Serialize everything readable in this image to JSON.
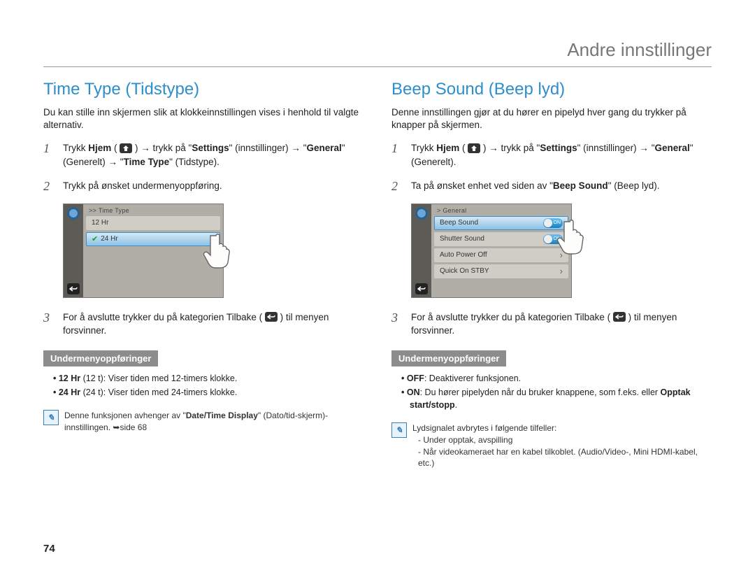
{
  "header": {
    "title": "Andre innstillinger"
  },
  "page_number": "74",
  "left": {
    "h2": "Time Type (Tidstype)",
    "intro": "Du kan stille inn skjermen slik at klokkeinnstillingen vises i henhold til valgte alternativ.",
    "step1": {
      "num": "1",
      "t1": "Trykk ",
      "hjem": "Hjem",
      "t2": " ( ",
      "t3": " ) ",
      "mid": " trykk på \"",
      "settings": "Settings",
      "t4": "\" (innstillinger) ",
      "t5": "\"",
      "general": "General",
      "t6": "\" (Generelt) ",
      "t7": " \"",
      "timetype": "Time Type",
      "t8": "\" (Tidstype)."
    },
    "step2": {
      "num": "2",
      "text": "Trykk på ønsket undermenyoppføring."
    },
    "shot": {
      "crumb": ">> Time Type",
      "opt1": "12 Hr",
      "opt2": "24 Hr"
    },
    "step3": {
      "num": "3",
      "a": "For å avslutte trykker du på kategorien Tilbake ( ",
      "b": " ) til menyen forsvinner."
    },
    "sub_hdr": "Undermenyoppføringer",
    "b1a": "12 Hr",
    "b1b": " (12 t): Viser tiden med 12-timers klokke.",
    "b2a": "24 Hr",
    "b2b": " (24 t): Viser tiden med 24-timers klokke.",
    "note": {
      "a": "Denne funksjonen avhenger av \"",
      "dt": "Date/Time Display",
      "b": "\" (Dato/tid-skjerm)-innstillingen. ",
      "ref": "side 68"
    }
  },
  "right": {
    "h2": "Beep Sound (Beep lyd)",
    "intro": "Denne innstillingen gjør at du hører en pipelyd hver gang du trykker på knapper på skjermen.",
    "step1": {
      "num": "1",
      "t1": "Trykk ",
      "hjem": "Hjem",
      "t2": " ( ",
      "t3": " ) ",
      "mid": " trykk på \"",
      "settings": "Settings",
      "t4": "\" (innstillinger) ",
      "t5": "\"",
      "general": "General",
      "t6": "\" (Generelt)."
    },
    "step2": {
      "num": "2",
      "a": "Ta på ønsket enhet ved siden av \"",
      "bs": "Beep Sound",
      "b": "\" (Beep lyd)."
    },
    "shot": {
      "crumb": "> General",
      "r1": "Beep Sound",
      "r2": "Shutter Sound",
      "r3": "Auto Power Off",
      "r4": "Quick On STBY",
      "on": "ON"
    },
    "step3": {
      "num": "3",
      "a": "For å avslutte trykker du på kategorien Tilbake ( ",
      "b": " ) til menyen forsvinner."
    },
    "sub_hdr": "Undermenyoppføringer",
    "b1a": "OFF",
    "b1b": ": Deaktiverer funksjonen.",
    "b2a": "ON",
    "b2b": ": Du hører pipelyden når du bruker knappene, som f.eks. eller ",
    "b2c": "Opptak start/stopp",
    "b2d": ".",
    "note": {
      "l1": "Lydsignalet avbrytes i følgende tilfeller:",
      "l2": "- Under opptak, avspilling",
      "l3": "- Når videokameraet har en kabel tilkoblet. (Audio/Video-, Mini HDMI-kabel, etc.)"
    }
  }
}
